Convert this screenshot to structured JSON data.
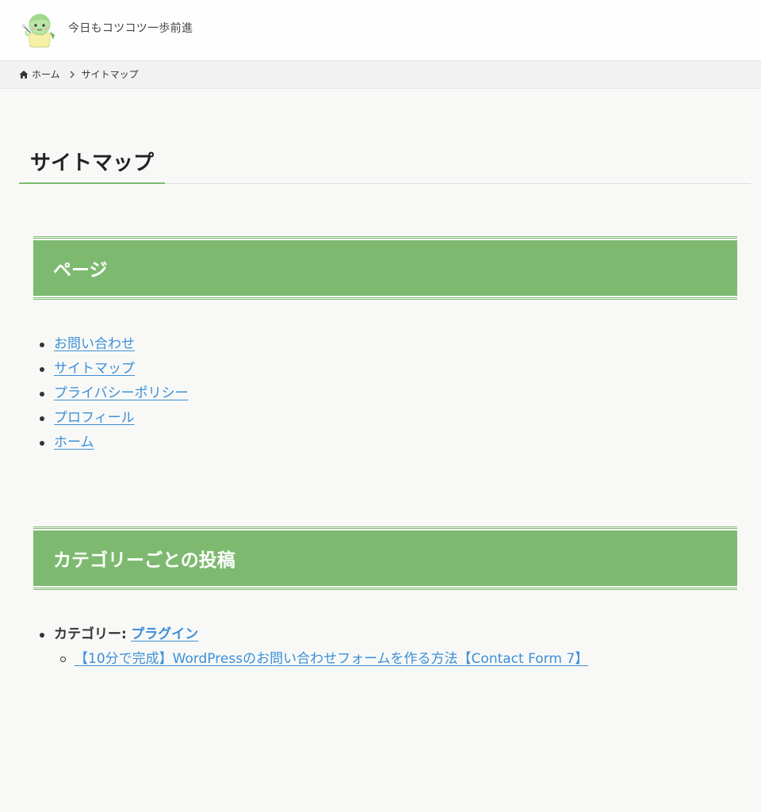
{
  "header": {
    "tagline": "今日もコツコツ一歩前進",
    "logo_icon": "mascot-logo-icon"
  },
  "breadcrumb": {
    "home_label": "ホーム",
    "current_label": "サイトマップ",
    "home_icon": "home-icon",
    "separator_icon": "chevron-right-icon"
  },
  "page": {
    "title": "サイトマップ"
  },
  "sections": {
    "pages": {
      "heading": "ページ",
      "items": [
        {
          "label": "お問い合わせ"
        },
        {
          "label": "サイトマップ"
        },
        {
          "label": "プライバシーポリシー"
        },
        {
          "label": "プロフィール"
        },
        {
          "label": "ホーム"
        }
      ]
    },
    "categories": {
      "heading": "カテゴリーごとの投稿",
      "category_prefix": "カテゴリー:",
      "items": [
        {
          "category": "プラグイン",
          "posts": [
            {
              "label": "【10分で完成】WordPressのお問い合わせフォームを作る方法【Contact Form 7】"
            }
          ]
        }
      ]
    }
  },
  "colors": {
    "accent": "#7dba70",
    "link": "#3c8fd8",
    "background": "#f8f9f7",
    "text": "#333333"
  }
}
